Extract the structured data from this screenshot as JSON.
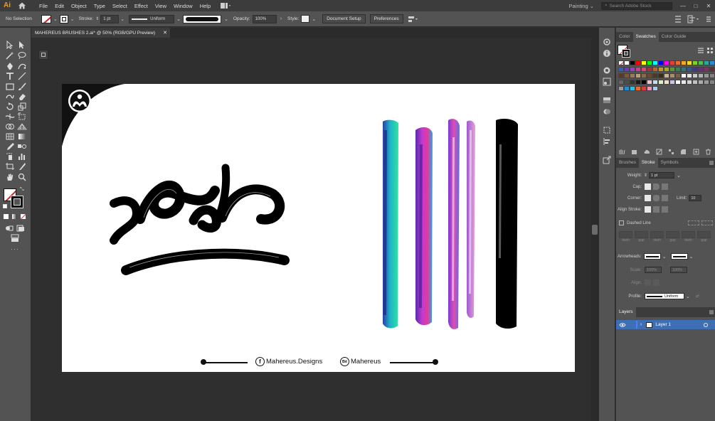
{
  "app": {
    "logo": "Ai",
    "menus": [
      "File",
      "Edit",
      "Object",
      "Type",
      "Select",
      "Effect",
      "View",
      "Window",
      "Help"
    ],
    "workspace": "Painting",
    "search_placeholder": "Search Adobe Stock",
    "window_buttons": [
      "—",
      "□",
      "✕"
    ]
  },
  "control_bar": {
    "selection": "No Selection",
    "stroke_label": "Stroke:",
    "stroke_value": "1 pt",
    "stroke_profile": "Uniform",
    "opacity_label": "Opacity:",
    "opacity_value": "100%",
    "style_label": "Style:",
    "document_setup": "Document Setup",
    "preferences": "Preferences"
  },
  "document": {
    "tab_title": "MAHEREUS BRUSHES 2.ai* @ 50% (RGB/GPU Preview)",
    "close": "✕"
  },
  "artboard": {
    "facebook_text": "Mahereus.Designs",
    "behance_text": "Mahereus",
    "facebook_icon_glyph": "f",
    "behance_icon_glyph": "Bē"
  },
  "panels": {
    "top_tabs": [
      "Color",
      "Swatches",
      "Color Guide"
    ],
    "active_top_tab": "Swatches",
    "mid_tabs": [
      "Brushes",
      "Stroke",
      "Symbols"
    ],
    "active_mid_tab": "Stroke",
    "stroke": {
      "weight_label": "Weight:",
      "weight_value": "1 pt",
      "cap_label": "Cap:",
      "corner_label": "Corner:",
      "limit_label": "Limit:",
      "limit_value": "10",
      "align_label": "Align Stroke:",
      "dashed_label": "Dashed Line",
      "dash_labels": [
        "dash",
        "gap",
        "dash",
        "gap",
        "dash",
        "gap"
      ],
      "arrowheads_label": "Arrowheads:",
      "scale_label": "Scale:",
      "scale_value1": "100%",
      "scale_value2": "100%",
      "align_arrow_label": "Align:",
      "profile_label": "Profile:",
      "profile_value": "Uniform"
    },
    "layers_tab": "Layers",
    "layer_name": "Layer 1"
  },
  "colors": {
    "accent": "#ff9a00",
    "selection_blue": "#3b77c4",
    "layer_color": "#4f7fff"
  }
}
